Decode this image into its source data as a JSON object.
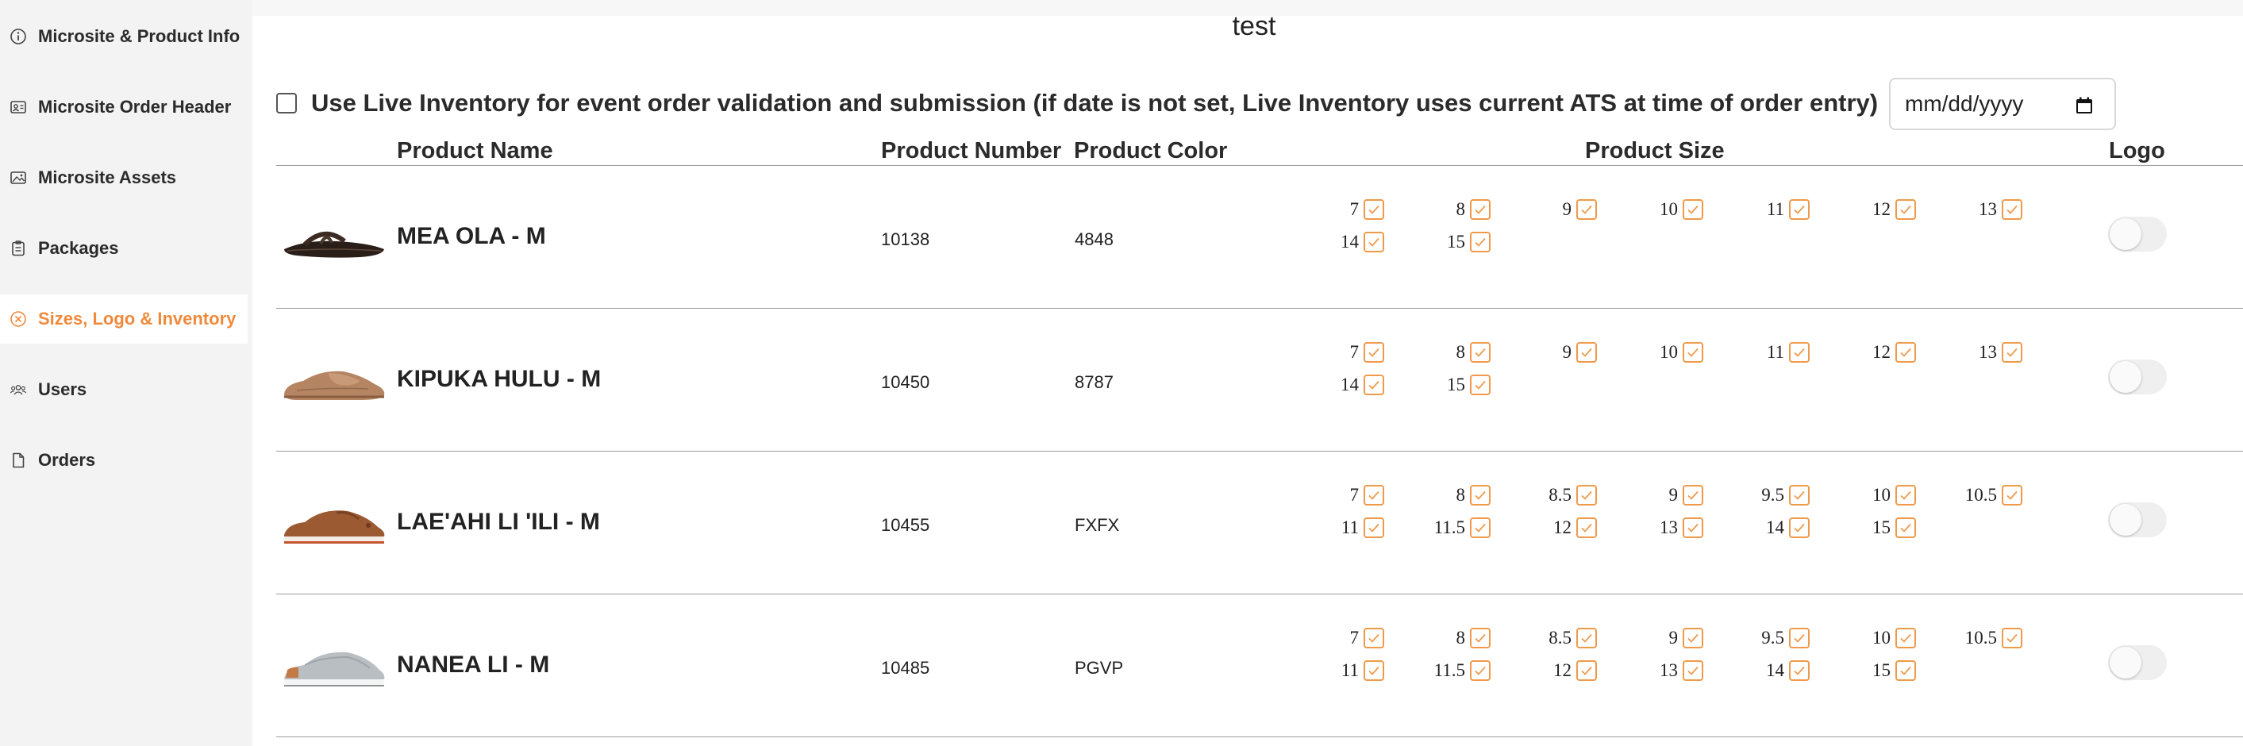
{
  "page": {
    "title": "test"
  },
  "sidebar": {
    "items": [
      {
        "label": "Microsite & Product Info",
        "icon": "info-circle-icon",
        "active": false
      },
      {
        "label": "Microsite Order Header",
        "icon": "id-card-icon",
        "active": false
      },
      {
        "label": "Microsite Assets",
        "icon": "image-icon",
        "active": false
      },
      {
        "label": "Packages",
        "icon": "clipboard-icon",
        "active": false
      },
      {
        "label": "Sizes, Logo & Inventory",
        "icon": "x-circle-icon",
        "active": true
      },
      {
        "label": "Users",
        "icon": "users-icon",
        "active": false
      },
      {
        "label": "Orders",
        "icon": "document-icon",
        "active": false
      }
    ]
  },
  "live_inventory": {
    "checked": false,
    "label": "Use Live Inventory for event order validation and submission (if date is not set, Live Inventory uses current ATS at time of order entry)",
    "date_placeholder": "mm/dd/yyyy"
  },
  "table": {
    "headers": {
      "name": "Product Name",
      "number": "Product Number",
      "color": "Product Color",
      "size": "Product Size",
      "logo": "Logo"
    },
    "rows": [
      {
        "name": "MEA OLA - M",
        "number": "10138",
        "color": "4848",
        "shoe": "sandal-image",
        "sizes": [
          "7",
          "8",
          "9",
          "10",
          "11",
          "12",
          "13",
          "14",
          "15"
        ],
        "logo_enabled": false
      },
      {
        "name": "KIPUKA HULU - M",
        "number": "10450",
        "color": "8787",
        "shoe": "slipper-image",
        "sizes": [
          "7",
          "8",
          "9",
          "10",
          "11",
          "12",
          "13",
          "14",
          "15"
        ],
        "logo_enabled": false
      },
      {
        "name": "LAE'AHI LI 'ILI - M",
        "number": "10455",
        "color": "FXFX",
        "shoe": "leather-sneaker-image",
        "sizes": [
          "7",
          "8",
          "8.5",
          "9",
          "9.5",
          "10",
          "10.5",
          "11",
          "11.5",
          "12",
          "13",
          "14",
          "15"
        ],
        "logo_enabled": false
      },
      {
        "name": "NANEA LI - M",
        "number": "10485",
        "color": "PGVP",
        "shoe": "knit-sneaker-image",
        "sizes": [
          "7",
          "8",
          "8.5",
          "9",
          "9.5",
          "10",
          "10.5",
          "11",
          "11.5",
          "12",
          "13",
          "14",
          "15"
        ],
        "logo_enabled": false
      }
    ]
  },
  "colors": {
    "accent": "#ef8a3c",
    "checkbox_border": "#ef9a4a",
    "sidebar_bg": "#f3f3f3"
  }
}
